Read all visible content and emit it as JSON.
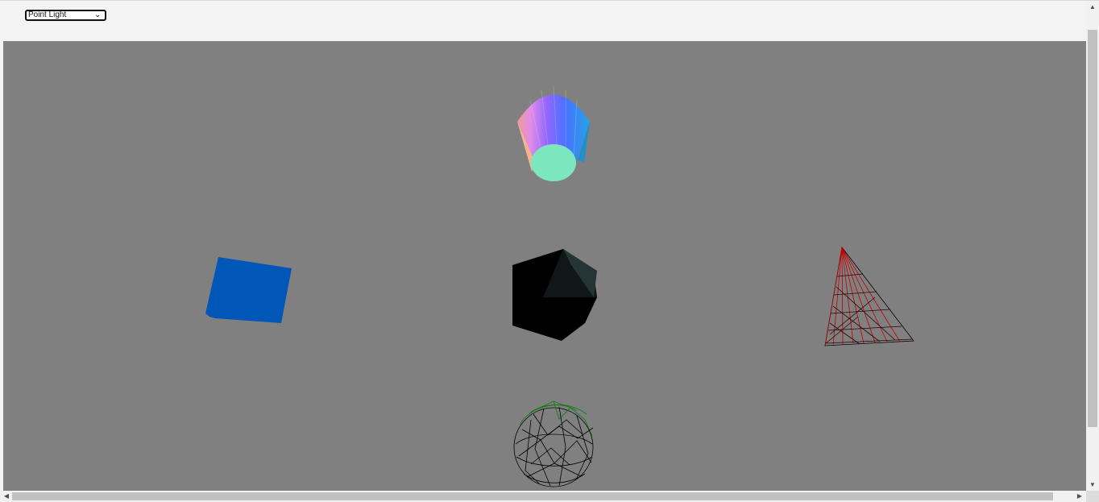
{
  "toolbar": {
    "light_select": {
      "selected": "Point Light"
    }
  },
  "scene": {
    "background_color": "#808080",
    "objects": [
      {
        "name": "colored-cone",
        "color": "#7ee6be"
      },
      {
        "name": "blue-cube",
        "color": "#0057b8"
      },
      {
        "name": "black-icosahedron",
        "color": "#000000"
      },
      {
        "name": "red-wireframe-cone",
        "color": "#ff0000"
      },
      {
        "name": "wireframe-sphere",
        "color": "#000000"
      }
    ]
  },
  "scrollbars": {
    "vertical": true,
    "horizontal": true
  }
}
